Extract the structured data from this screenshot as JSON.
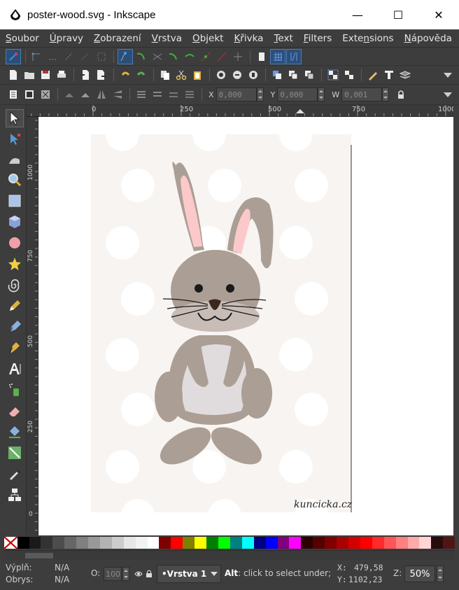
{
  "window": {
    "title": "poster-wood.svg - Inkscape",
    "minimize_symbol": "—",
    "maximize_symbol": "☐",
    "close_symbol": "✕"
  },
  "menu": [
    {
      "label": "Soubor",
      "key": "S"
    },
    {
      "label": "Úpravy",
      "key": "Ú"
    },
    {
      "label": "Zobrazení",
      "key": "Z"
    },
    {
      "label": "Vrstva",
      "key": "V"
    },
    {
      "label": "Objekt",
      "key": "O"
    },
    {
      "label": "Křivka",
      "key": "K"
    },
    {
      "label": "Text",
      "key": "T"
    },
    {
      "label": "Filters",
      "key": "F"
    },
    {
      "label": "Extensions",
      "key": "n"
    },
    {
      "label": "Nápověda",
      "key": "N"
    }
  ],
  "transform_toolbar": {
    "x_label": "X",
    "x_value": "0,000",
    "y_label": "Y",
    "y_value": "0,000",
    "w_label": "W",
    "w_value": "0,001"
  },
  "hruler_labels": [
    "0",
    "250",
    "500",
    "750",
    "1000"
  ],
  "vruler_labels": [
    "1000",
    "750",
    "500",
    "250",
    "0"
  ],
  "canvas": {
    "watermark": "kuncicka.cz",
    "background_color": "#f7f4f1",
    "dot_color": "#ffffff",
    "bunny_color": "#ab9e94",
    "ear_inner_color": "#fbc9c9",
    "belly_color": "#e0dcde"
  },
  "palette": [
    "#000000",
    "#1a1a1a",
    "#333333",
    "#4d4d4d",
    "#666666",
    "#808080",
    "#999999",
    "#b3b3b3",
    "#cccccc",
    "#e6e6e6",
    "#f2f2f2",
    "#ffffff",
    "#800000",
    "#ff0000",
    "#808000",
    "#ffff00",
    "#008000",
    "#00ff00",
    "#008080",
    "#00ffff",
    "#000080",
    "#0000ff",
    "#800080",
    "#ff00ff",
    "#2b0000",
    "#550000",
    "#800000",
    "#aa0000",
    "#d40000",
    "#ff0000",
    "#ff2a2a",
    "#ff5555",
    "#ff8080",
    "#ffaaaa",
    "#ffd5d5",
    "#280b0b",
    "#501616"
  ],
  "status": {
    "fill_label": "Výplň:",
    "fill_value": "N/A",
    "stroke_label": "Obrys:",
    "stroke_value": "N/A",
    "opacity_label": "O:",
    "opacity_value": "100",
    "layer_name": "•Vrstva 1",
    "message_key": "Alt",
    "message_text": ": click to select under;",
    "x_label": "X:",
    "x_value": "479,58",
    "y_label": "Y:",
    "y_value": "1102,23",
    "zoom_label": "Z:",
    "zoom_value": "50%"
  }
}
